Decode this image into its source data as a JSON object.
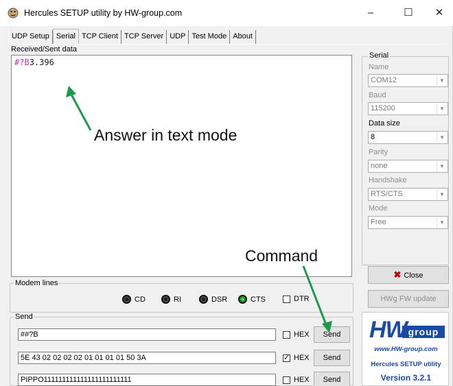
{
  "window": {
    "title": "Hercules SETUP utility by HW-group.com",
    "minimize": "–",
    "maximize": "☐",
    "close": "✕"
  },
  "tabs": [
    {
      "label": "UDP Setup",
      "active": false
    },
    {
      "label": "Serial",
      "active": true
    },
    {
      "label": "TCP Client",
      "active": false
    },
    {
      "label": "TCP Server",
      "active": false
    },
    {
      "label": "UDP",
      "active": false
    },
    {
      "label": "Test Mode",
      "active": false
    },
    {
      "label": "About",
      "active": false
    }
  ],
  "received": {
    "label": "Received/Sent data",
    "prefix": "#?B",
    "value": "3.396"
  },
  "annotations": {
    "answer": "Answer in text mode",
    "command": "Command"
  },
  "modem": {
    "label": "Modem lines",
    "cd": "CD",
    "ri": "RI",
    "dsr": "DSR",
    "cts": "CTS",
    "dtr": "DTR"
  },
  "send": {
    "label": "Send",
    "rows": [
      {
        "value": "##?B",
        "hex_label": "HEX",
        "hex_checked": false,
        "button": "Send"
      },
      {
        "value": "5E 43 02 02 02 02 01 01 01 01 50 3A",
        "hex_label": "HEX",
        "hex_checked": true,
        "button": "Send"
      },
      {
        "value": "PIPPO111111111111111111111111",
        "hex_label": "HEX",
        "hex_checked": false,
        "button": "Send"
      }
    ]
  },
  "serial": {
    "label": "Serial",
    "name_label": "Name",
    "name_value": "COM12",
    "baud_label": "Baud",
    "baud_value": "115200",
    "datasize_label": "Data size",
    "datasize_value": "8",
    "parity_label": "Parity",
    "parity_value": "none",
    "handshake_label": "Handshake",
    "handshake_value": "RTS/CTS",
    "mode_label": "Mode",
    "mode_value": "Free",
    "close_button": "Close",
    "fw_update_button": "HWg FW update"
  },
  "logo": {
    "hw": "HW",
    "group": "group",
    "url": "www.HW-group.com",
    "name": "Hercules SETUP utility",
    "version": "Version  3.2.1"
  },
  "colors": {
    "annotation_arrow": "#1a9a4a",
    "recv_prefix": "#c12fc1",
    "brand_blue": "#1a4aa6"
  }
}
